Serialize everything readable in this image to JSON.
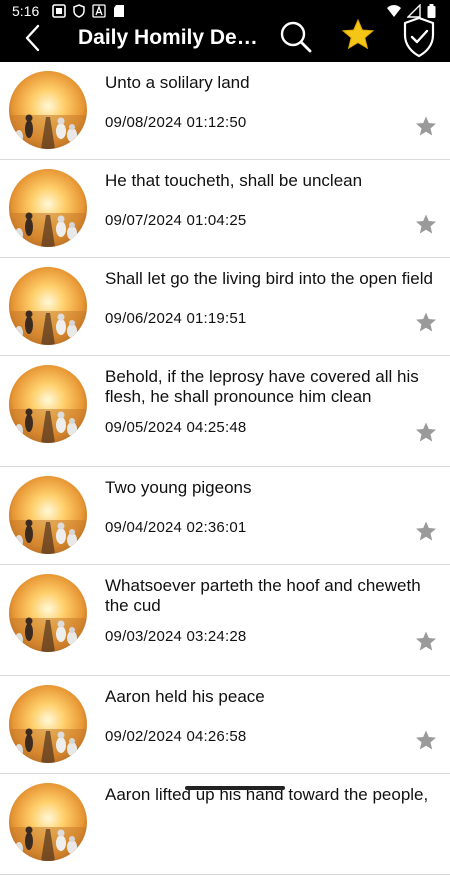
{
  "status_bar": {
    "time": "5:16",
    "left_icons": [
      "gallery-icon",
      "shield-status-icon",
      "text-a-icon",
      "sd-card-icon"
    ],
    "right_icons": [
      "wifi-icon",
      "signal-icon",
      "battery-icon"
    ]
  },
  "toolbar": {
    "title": "Daily Homily De…",
    "back_icon": "chevron-left-icon",
    "search_icon": "search-icon",
    "favorites_icon": "star-icon",
    "shield_icon": "shield-check-icon"
  },
  "entries": [
    {
      "title": "Unto a solilary land",
      "date": "09/08/2024 01:12:50"
    },
    {
      "title": "He that toucheth, shall be unclean",
      "date": "09/07/2024 01:04:25"
    },
    {
      "title": "Shall let go the living bird into the open field",
      "date": "09/06/2024 01:19:51"
    },
    {
      "title": "Behold, if the leprosy have covered all his flesh, he shall pronounce him clean",
      "date": "09/05/2024 04:25:48"
    },
    {
      "title": "Two young pigeons",
      "date": "09/04/2024 02:36:01"
    },
    {
      "title": "Whatsoever parteth the hoof and cheweth the cud",
      "date": "09/03/2024 03:24:28"
    },
    {
      "title": "Aaron held his peace",
      "date": "09/02/2024 04:26:58"
    },
    {
      "title": "Aaron lifted up his hand toward the people,",
      "date": ""
    }
  ],
  "colors": {
    "header_bg": "#000000",
    "star_gold": "#f5c518",
    "row_star_gray": "#9a9a9a",
    "divider": "#d9d9d9"
  }
}
